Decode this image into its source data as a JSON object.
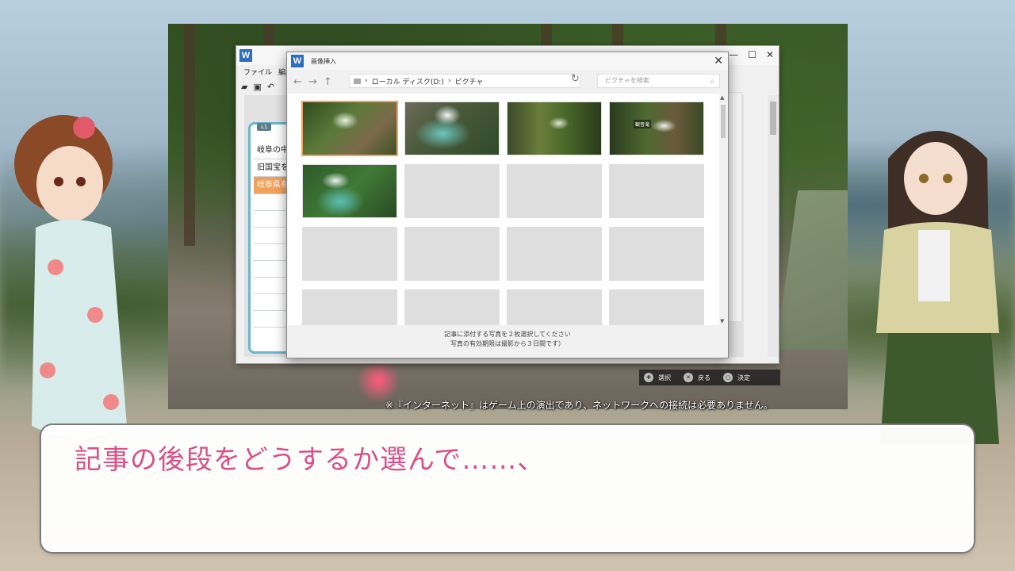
{
  "editor": {
    "menu": [
      "ファイル",
      "編集"
    ],
    "toolbar_icons": [
      "folder-open-icon",
      "save-icon",
      "undo-icon"
    ],
    "window_buttons": [
      "—",
      "☐",
      "✕"
    ],
    "layer_tag": "L1",
    "layers": [
      "岐阜の中",
      "旧国宝を",
      "岐阜県有"
    ],
    "selected_layer_index": 2
  },
  "dialog": {
    "title": "画像挿入",
    "breadcrumb_drive": "ローカル ディスク(D:)",
    "breadcrumb_folder": "ピクチャ",
    "search_placeholder": "ピクチャを検索",
    "thumb_label": "観音滝",
    "message_line1": "記事に添付する写真を２枚選択してください",
    "message_line2": "写真の有効期限は撮影から３日間です）",
    "photos_count": 5,
    "empty_slots": 11,
    "selected_photo_index": 0
  },
  "hints": {
    "select": "選択",
    "back": "戻る",
    "confirm": "決定"
  },
  "notice": "※『インターネット』はゲーム上の演出であり、ネットワークへの接続は必要ありません。",
  "dialogue": {
    "text": "記事の後段をどうするか選んで……、"
  },
  "colors": {
    "dialogue_text": "#d94f86",
    "selection": "#f4a35a",
    "layer_panel_border": "#69b7cc"
  }
}
